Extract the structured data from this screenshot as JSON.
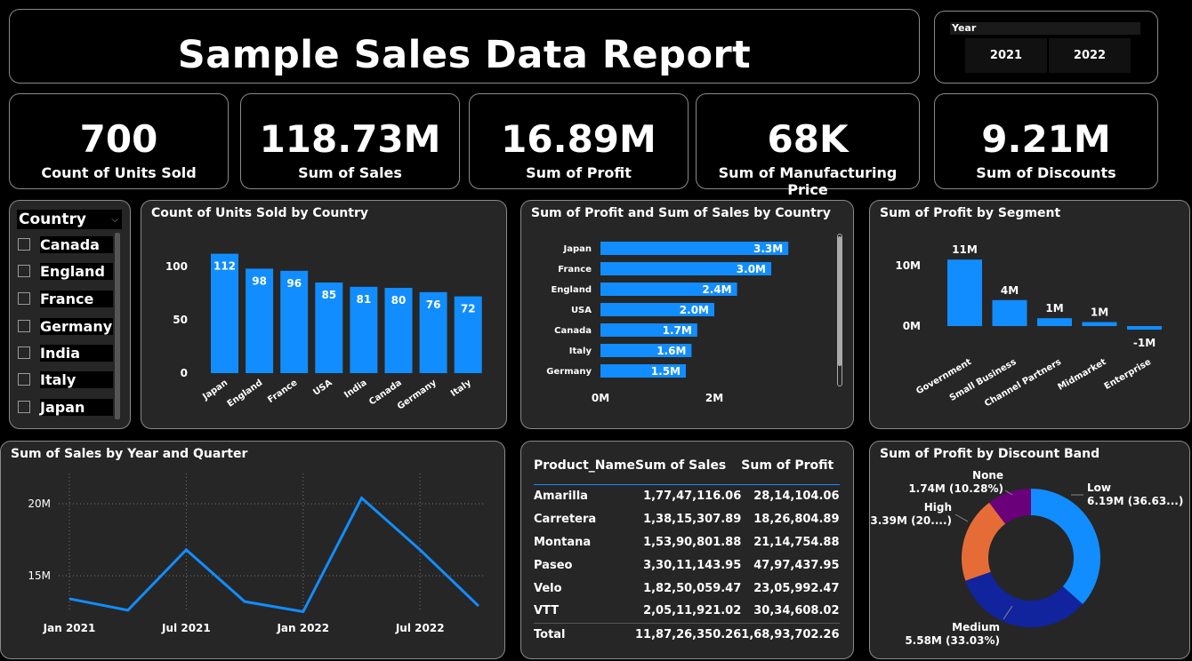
{
  "report_title": "Sample Sales Data Report",
  "year_slicer": {
    "header": "Year",
    "options": [
      "2021",
      "2022"
    ]
  },
  "kpis": [
    {
      "value": "700",
      "label": "Count of Units Sold"
    },
    {
      "value": "118.73M",
      "label": "Sum of Sales"
    },
    {
      "value": "16.89M",
      "label": "Sum of Profit"
    },
    {
      "value": "68K",
      "label": "Sum of Manufacturing Price"
    },
    {
      "value": "9.21M",
      "label": "Sum of Discounts"
    }
  ],
  "country_slicer": {
    "header": "Country",
    "items": [
      "Canada",
      "England",
      "France",
      "Germany",
      "India",
      "Italy",
      "Japan"
    ]
  },
  "colors": {
    "bar": "#118dff",
    "background": "#000000",
    "panel": "#262626"
  },
  "chart_data": [
    {
      "type": "bar",
      "title": "Count of Units Sold by Country",
      "categories": [
        "Japan",
        "England",
        "France",
        "USA",
        "India",
        "Canada",
        "Germany",
        "Italy"
      ],
      "values": [
        112,
        98,
        96,
        85,
        81,
        80,
        76,
        72
      ],
      "data_labels": [
        "112",
        "98",
        "96",
        "85",
        "81",
        "80",
        "76",
        "72"
      ],
      "ylim": [
        0,
        120
      ],
      "yticks": [
        "0",
        "50",
        "100"
      ]
    },
    {
      "type": "bar",
      "orientation": "horizontal",
      "title": "Sum of Profit and Sum of Sales by Country",
      "categories": [
        "Japan",
        "France",
        "England",
        "USA",
        "Canada",
        "Italy",
        "Germany"
      ],
      "values": [
        3.3,
        3.0,
        2.4,
        2.0,
        1.7,
        1.6,
        1.5
      ],
      "data_labels": [
        "3.3M",
        "3.0M",
        "2.4M",
        "2.0M",
        "1.7M",
        "1.6M",
        "1.5M"
      ],
      "xticks": [
        "0M",
        "2M"
      ]
    },
    {
      "type": "bar",
      "title": "Sum of Profit by Segment",
      "categories": [
        "Government",
        "Small Business",
        "Channel Partners",
        "Midmarket",
        "Enterprise"
      ],
      "values": [
        11,
        4.3,
        1.3,
        0.66,
        -0.6
      ],
      "data_labels": [
        "11M",
        "4M",
        "1M",
        "1M",
        "-1M"
      ],
      "yticks": [
        "0M",
        "10M"
      ]
    },
    {
      "type": "line",
      "title": "Sum of Sales by Year and Quarter",
      "values": [
        13.4,
        12.6,
        16.8,
        13.2,
        12.5,
        20.4,
        16.8,
        12.9
      ],
      "xticks": [
        "Jan 2021",
        "Jul 2021",
        "Jan 2022",
        "Jul 2022"
      ],
      "yticks": [
        "15M",
        "20M"
      ]
    },
    {
      "type": "pie",
      "title": "Sum of Profit by Discount Band",
      "slices": [
        {
          "name": "Low",
          "value": 36.63,
          "label": "6.19M (36.63...)",
          "color": "#118dff"
        },
        {
          "name": "Medium",
          "value": 33.03,
          "label": "5.58M (33.03%)",
          "color": "#12239e"
        },
        {
          "name": "High",
          "value": 20.06,
          "label": "3.39M (20....)",
          "color": "#e66c37"
        },
        {
          "name": "None",
          "value": 10.28,
          "label": "1.74M (10.28%)",
          "color": "#6b007b"
        }
      ]
    }
  ],
  "product_table": {
    "headers": [
      "Product_Name",
      "Sum of Sales",
      "Sum of Profit"
    ],
    "rows": [
      [
        "Amarilla",
        "1,77,47,116.06",
        "28,14,104.06"
      ],
      [
        "Carretera",
        "1,38,15,307.89",
        "18,26,804.89"
      ],
      [
        "Montana",
        "1,53,90,801.88",
        "21,14,754.88"
      ],
      [
        "Paseo",
        "3,30,11,143.95",
        "47,97,437.95"
      ],
      [
        "Velo",
        "1,82,50,059.47",
        "23,05,992.47"
      ],
      [
        "VTT",
        "2,05,11,921.02",
        "30,34,608.02"
      ]
    ],
    "total": [
      "Total",
      "11,87,26,350.26",
      "1,68,93,702.26"
    ]
  }
}
